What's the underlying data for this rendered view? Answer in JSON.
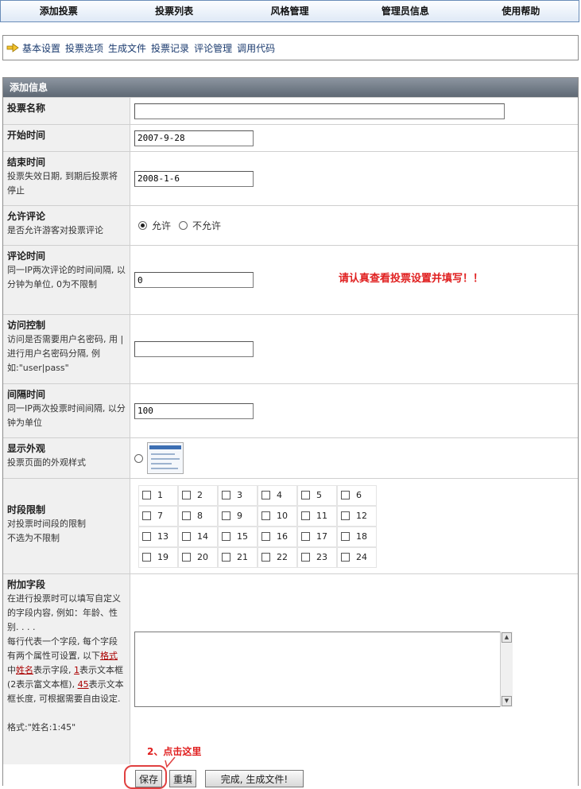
{
  "topnav": [
    "添加投票",
    "投票列表",
    "风格管理",
    "管理员信息",
    "使用帮助"
  ],
  "subnav": [
    "基本设置",
    "投票选项",
    "生成文件",
    "投票记录",
    "评论管理",
    "调用代码"
  ],
  "panel": {
    "title": "添加信息",
    "name": {
      "label": "投票名称",
      "value": ""
    },
    "start": {
      "label": "开始时间",
      "value": "2007-9-28"
    },
    "end": {
      "label": "结束时间",
      "help": "投票失效日期, 到期后投票将停止",
      "value": "2008-1-6"
    },
    "comment": {
      "label": "允许评论",
      "help": "是否允许游客对投票评论",
      "opt_allow": "允许",
      "opt_deny": "不允许"
    },
    "comment_time": {
      "label": "评论时间",
      "help": "同一IP两次评论的时间间隔, 以分钟为单位, 0为不限制",
      "value": "0"
    },
    "warning": "请认真查看投票设置并填写！！",
    "access": {
      "label": "访问控制",
      "help": "访问是否需要用户名密码, 用 |进行用户名密码分隔, 例如:\"user|pass\"",
      "value": ""
    },
    "interval": {
      "label": "间隔时间",
      "help": "同一IP两次投票时间间隔, 以分钟为单位",
      "value": "100"
    },
    "appearance": {
      "label": "显示外观",
      "help": "投票页面的外观样式"
    },
    "timeslot": {
      "label": "时段限制",
      "help1": "对投票时间段的限制",
      "help2": "不选为不限制",
      "hours": [
        "1",
        "2",
        "3",
        "4",
        "5",
        "6",
        "7",
        "8",
        "9",
        "10",
        "11",
        "12",
        "13",
        "14",
        "15",
        "16",
        "17",
        "18",
        "19",
        "20",
        "21",
        "22",
        "23",
        "24"
      ]
    },
    "extra": {
      "label": "附加字段",
      "help1": "在进行投票时可以填写自定义的字段内容, 例如：年龄、性别. . . .",
      "help2a": "每行代表一个字段, 每个字段有两个属性可设置, 以下",
      "fmt": "格式",
      "mid": "中",
      "nm": "姓名",
      "help2b": "表示字段, ",
      "n1": "1",
      "help2c": "表示文本框(2表示富文本框), ",
      "n45": "45",
      "help2d": "表示文本框长度, 可根据需要自由设定.",
      "format": "格式:\"姓名:1:45\""
    }
  },
  "annotation": "2、点击这里",
  "buttons": {
    "save": "保存",
    "reset": "重填",
    "generate": "完成, 生成文件!"
  }
}
